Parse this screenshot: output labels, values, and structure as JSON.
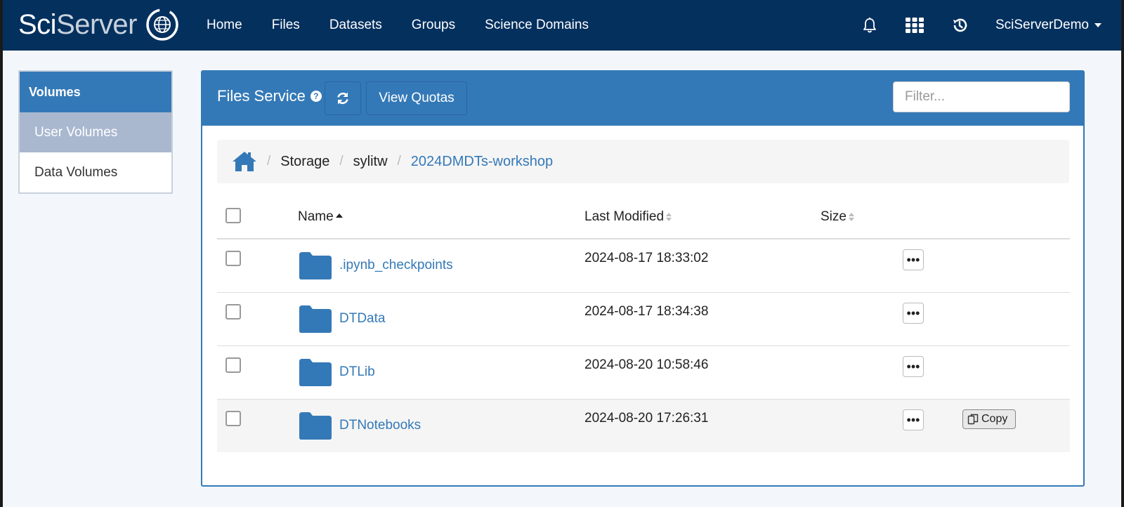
{
  "navbar": {
    "brand_sci": "Sci",
    "brand_server": "Server",
    "links": [
      "Home",
      "Files",
      "Datasets",
      "Groups",
      "Science Domains"
    ],
    "icons": [
      "bell-icon",
      "apps-grid-icon",
      "history-icon"
    ],
    "user": "SciServerDemo"
  },
  "sidebar": {
    "header": "Volumes",
    "items": [
      {
        "label": "User Volumes",
        "active": true
      },
      {
        "label": "Data Volumes",
        "active": false
      }
    ]
  },
  "panel": {
    "title": "Files Service",
    "help_icon": "question-circle-icon",
    "refresh_icon": "refresh-icon",
    "quota_label": "View Quotas",
    "filter_placeholder": "Filter..."
  },
  "breadcrumb": {
    "home_icon": "home-icon",
    "items": [
      "Storage",
      "sylitw",
      "2024DMDTs-workshop"
    ]
  },
  "table": {
    "headers": {
      "name": "Name",
      "modified": "Last Modified",
      "size": "Size"
    },
    "rows": [
      {
        "name": ".ipynb_checkpoints",
        "modified": "2024-08-17 18:33:02",
        "size": ""
      },
      {
        "name": "DTData",
        "modified": "2024-08-17 18:34:38",
        "size": ""
      },
      {
        "name": "DTLib",
        "modified": "2024-08-20 10:58:46",
        "size": ""
      },
      {
        "name": "DTNotebooks",
        "modified": "2024-08-20 17:26:31",
        "size": ""
      }
    ],
    "more_label": "•••",
    "copy_label": "Copy"
  },
  "colors": {
    "navbar": "#04305e",
    "accent": "#3479b7",
    "sidebar_active": "#a9b8cf"
  }
}
